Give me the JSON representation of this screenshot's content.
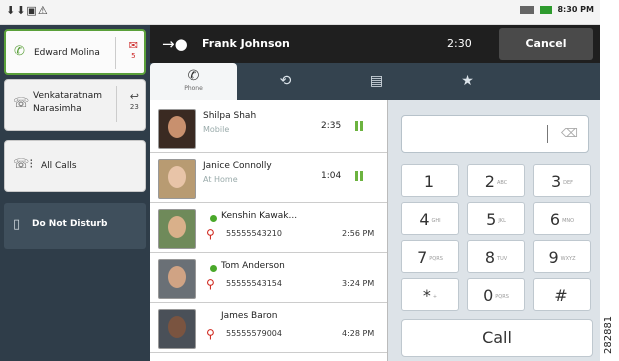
{
  "status_bar": {
    "time": "8:30 PM"
  },
  "sidebar": {
    "items": [
      {
        "label": "Edward Molina",
        "badge": "5"
      },
      {
        "label_line1": "Venkataratnam",
        "label_line2": "Narasimha",
        "badge": "23"
      },
      {
        "label": "All Calls"
      },
      {
        "label": "Do Not Disturb"
      }
    ]
  },
  "call_bar": {
    "contact": "Frank Johnson",
    "duration": "2:30",
    "cancel_label": "Cancel"
  },
  "tabs": [
    {
      "label": "Phone",
      "icon": "phone-icon"
    },
    {
      "icon": "recent-icon"
    },
    {
      "icon": "contacts-icon"
    },
    {
      "icon": "star-icon"
    }
  ],
  "list": [
    {
      "name": "Shilpa Shah",
      "sub": "Mobile",
      "duration": "2:35",
      "state": "held"
    },
    {
      "name": "Janice Connolly",
      "sub": "At Home",
      "duration": "1:04",
      "state": "held"
    },
    {
      "name": "Kenshin Kawak...",
      "number": "55555543210",
      "time": "2:56 PM",
      "presence": "available"
    },
    {
      "name": "Tom Anderson",
      "number": "55555543154",
      "time": "3:24 PM",
      "presence": "available"
    },
    {
      "name": "James Baron",
      "number": "55555579004",
      "time": "4:28 PM"
    }
  ],
  "keypad": {
    "keys": [
      {
        "num": "1",
        "letters": ""
      },
      {
        "num": "2",
        "letters": "ABC"
      },
      {
        "num": "3",
        "letters": "DEF"
      },
      {
        "num": "4",
        "letters": "GHI"
      },
      {
        "num": "5",
        "letters": "JKL"
      },
      {
        "num": "6",
        "letters": "MNO"
      },
      {
        "num": "7",
        "letters": "PQRS"
      },
      {
        "num": "8",
        "letters": "TUV"
      },
      {
        "num": "9",
        "letters": "WXYZ"
      },
      {
        "num": "*",
        "letters": "+"
      },
      {
        "num": "0",
        "letters": "PQRS"
      },
      {
        "num": "#",
        "letters": ""
      }
    ],
    "call_label": "Call"
  },
  "figure_code": "282881",
  "colors": {
    "presence": "#4aa82a",
    "missed": "#d0281e",
    "held": "#6cb33f",
    "sidebar_bg": "#2f3d49"
  }
}
